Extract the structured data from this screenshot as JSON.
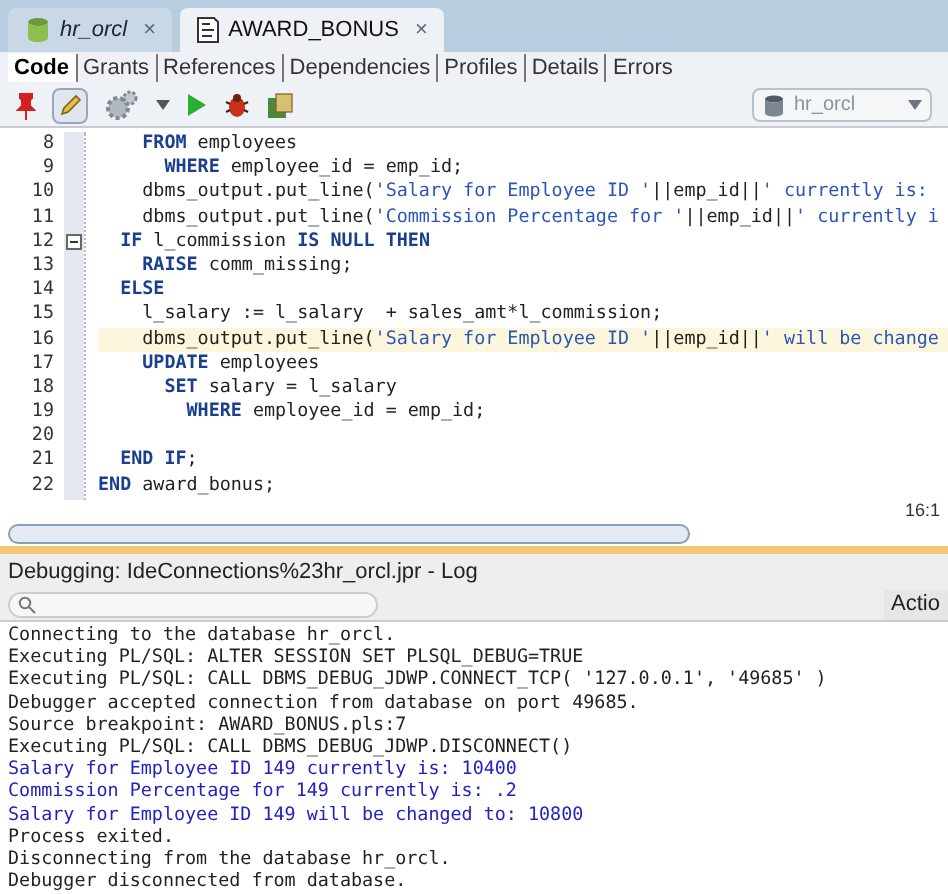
{
  "editor_tabs": [
    {
      "kind": "connection",
      "label": "hr_orcl",
      "close": "×",
      "selected": false
    },
    {
      "kind": "procedure",
      "label": "AWARD_BONUS",
      "close": "×",
      "selected": true
    }
  ],
  "view_tabs": [
    {
      "label": "Code",
      "selected": true
    },
    {
      "label": "Grants",
      "selected": false
    },
    {
      "label": "References",
      "selected": false
    },
    {
      "label": "Dependencies",
      "selected": false
    },
    {
      "label": "Profiles",
      "selected": false
    },
    {
      "label": "Details",
      "selected": false
    },
    {
      "label": "Errors",
      "selected": false
    }
  ],
  "connection_select": {
    "value": "hr_orcl"
  },
  "code_lines": [
    {
      "number": "8",
      "current": false,
      "segments": [
        {
          "kind": "kw",
          "text": "    FROM"
        },
        {
          "kind": "plain",
          "text": " employees"
        }
      ]
    },
    {
      "number": "9",
      "current": false,
      "segments": [
        {
          "kind": "kw",
          "text": "      WHERE"
        },
        {
          "kind": "plain",
          "text": " employee_id = emp_id;"
        }
      ]
    },
    {
      "number": "10",
      "current": false,
      "segments": [
        {
          "kind": "plain",
          "text": "    dbms_output.put_line("
        },
        {
          "kind": "str",
          "text": "'Salary for Employee ID '"
        },
        {
          "kind": "plain",
          "text": "||emp_id||"
        },
        {
          "kind": "str",
          "text": "' currently is:"
        }
      ]
    },
    {
      "number": "11",
      "current": false,
      "segments": [
        {
          "kind": "plain",
          "text": "    dbms_output.put_line("
        },
        {
          "kind": "str",
          "text": "'Commission Percentage for '"
        },
        {
          "kind": "plain",
          "text": "||emp_id||"
        },
        {
          "kind": "str",
          "text": "' currently i"
        }
      ]
    },
    {
      "number": "12",
      "fold": true,
      "current": false,
      "segments": [
        {
          "kind": "kw",
          "text": "  IF"
        },
        {
          "kind": "plain",
          "text": " l_commission "
        },
        {
          "kind": "kw",
          "text": "IS NULL THEN"
        }
      ]
    },
    {
      "number": "13",
      "current": false,
      "segments": [
        {
          "kind": "kw",
          "text": "    RAISE"
        },
        {
          "kind": "plain",
          "text": " comm_missing;"
        }
      ]
    },
    {
      "number": "14",
      "current": false,
      "segments": [
        {
          "kind": "kw",
          "text": "  ELSE"
        }
      ]
    },
    {
      "number": "15",
      "current": false,
      "segments": [
        {
          "kind": "plain",
          "text": "    l_salary := l_salary  + sales_amt*l_commission;"
        }
      ]
    },
    {
      "number": "16",
      "current": true,
      "segments": [
        {
          "kind": "plain",
          "text": "    dbms_output.put_line("
        },
        {
          "kind": "str",
          "text": "'Salary for Employee ID '"
        },
        {
          "kind": "plain",
          "text": "||emp_id||"
        },
        {
          "kind": "str",
          "text": "' will be change"
        }
      ]
    },
    {
      "number": "17",
      "current": false,
      "segments": [
        {
          "kind": "kw",
          "text": "    UPDATE"
        },
        {
          "kind": "plain",
          "text": " employees"
        }
      ]
    },
    {
      "number": "18",
      "current": false,
      "segments": [
        {
          "kind": "kw",
          "text": "      SET"
        },
        {
          "kind": "plain",
          "text": " salary = l_salary"
        }
      ]
    },
    {
      "number": "19",
      "current": false,
      "segments": [
        {
          "kind": "kw",
          "text": "        WHERE"
        },
        {
          "kind": "plain",
          "text": " employee_id = emp_id;"
        }
      ]
    },
    {
      "number": "20",
      "current": false
    },
    {
      "number": "21",
      "current": false,
      "segments": [
        {
          "kind": "kw",
          "text": "  END IF"
        },
        {
          "kind": "plain",
          "text": ";"
        }
      ]
    },
    {
      "number": "22",
      "current": false,
      "segments": [
        {
          "kind": "kw",
          "text": "END"
        },
        {
          "kind": "plain",
          "text": " award_bonus;"
        }
      ]
    }
  ],
  "cursor_position": "16:1",
  "log_panel": {
    "title": "Debugging: IdeConnections%23hr_orcl.jpr - Log",
    "actions_button": "Actio",
    "lines": [
      {
        "kind": "info",
        "text": "Connecting to the database hr_orcl."
      },
      {
        "kind": "info",
        "text": "Executing PL/SQL: ALTER SESSION SET PLSQL_DEBUG=TRUE"
      },
      {
        "kind": "info",
        "text": "Executing PL/SQL: CALL DBMS_DEBUG_JDWP.CONNECT_TCP( '127.0.0.1', '49685' )"
      },
      {
        "kind": "info",
        "text": "Debugger accepted connection from database on port 49685."
      },
      {
        "kind": "info",
        "text": "Source breakpoint: AWARD_BONUS.pls:7"
      },
      {
        "kind": "info",
        "text": "Executing PL/SQL: CALL DBMS_DEBUG_JDWP.DISCONNECT()"
      },
      {
        "kind": "output",
        "text": "Salary for Employee ID 149 currently is: 10400"
      },
      {
        "kind": "output",
        "text": "Commission Percentage for 149 currently is: .2"
      },
      {
        "kind": "output",
        "text": "Salary for Employee ID 149 will be changed to: 10800"
      },
      {
        "kind": "info",
        "text": "Process exited."
      },
      {
        "kind": "info",
        "text": "Disconnecting from the database hr_orcl."
      },
      {
        "kind": "info",
        "text": "Debugger disconnected from database."
      }
    ]
  }
}
